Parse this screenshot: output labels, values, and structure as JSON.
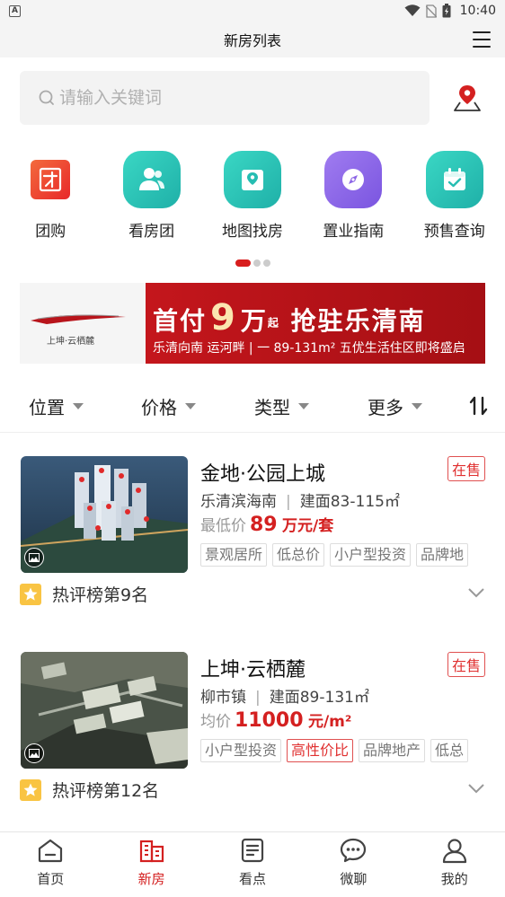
{
  "status_bar": {
    "time": "10:40"
  },
  "header": {
    "title": "新房列表"
  },
  "search": {
    "placeholder": "请输入关键词"
  },
  "quick_nav": [
    {
      "label": "团购",
      "icon": "group-buy-icon",
      "color": "#ea4a2a"
    },
    {
      "label": "看房团",
      "icon": "viewing-group-icon",
      "color": "#2cc4b8"
    },
    {
      "label": "地图找房",
      "icon": "map-search-icon",
      "color": "#2cc4b8"
    },
    {
      "label": "置业指南",
      "icon": "compass-icon",
      "color": "#8b63e6"
    },
    {
      "label": "预售查询",
      "icon": "calendar-check-icon",
      "color": "#2cc4b8"
    }
  ],
  "banner": {
    "brand": "上坤·云栖麓",
    "headline_a": "首付",
    "headline_num": "9",
    "headline_b": "万",
    "headline_sep": "起",
    "headline_c": "抢驻乐清南",
    "subline": "乐清向南 运河畔 | 一 89-131m² 五优生活住区即将盛启"
  },
  "filters": [
    {
      "label": "位置"
    },
    {
      "label": "价格"
    },
    {
      "label": "类型"
    },
    {
      "label": "更多"
    }
  ],
  "listings": [
    {
      "name": "金地·公园上城",
      "status": "在售",
      "district": "乐清滨海南",
      "area": "建面83-115㎡",
      "price_label": "最低价",
      "price_value": "89",
      "price_unit": "万元/套",
      "tags": [
        {
          "text": "景观居所",
          "highlight": false
        },
        {
          "text": "低总价",
          "highlight": false
        },
        {
          "text": "小户型投资",
          "highlight": false
        },
        {
          "text": "品牌地",
          "highlight": false
        }
      ],
      "rank": "热评榜第9名"
    },
    {
      "name": "上坤·云栖麓",
      "status": "在售",
      "district": "柳市镇",
      "area": "建面89-131㎡",
      "price_label": "均价",
      "price_value": "11000",
      "price_unit": "元/m²",
      "tags": [
        {
          "text": "小户型投资",
          "highlight": false
        },
        {
          "text": "高性价比",
          "highlight": true
        },
        {
          "text": "品牌地产",
          "highlight": false
        },
        {
          "text": "低总",
          "highlight": false
        }
      ],
      "rank": "热评榜第12名"
    }
  ],
  "tab_bar": [
    {
      "label": "首页",
      "icon": "home-icon",
      "active": false
    },
    {
      "label": "新房",
      "icon": "new-house-icon",
      "active": true
    },
    {
      "label": "看点",
      "icon": "article-icon",
      "active": false
    },
    {
      "label": "微聊",
      "icon": "chat-icon",
      "active": false
    },
    {
      "label": "我的",
      "icon": "profile-icon",
      "active": false
    }
  ],
  "colors": {
    "accent": "#d42020",
    "teal": "#2cc4b8",
    "purple": "#8b63e6"
  }
}
